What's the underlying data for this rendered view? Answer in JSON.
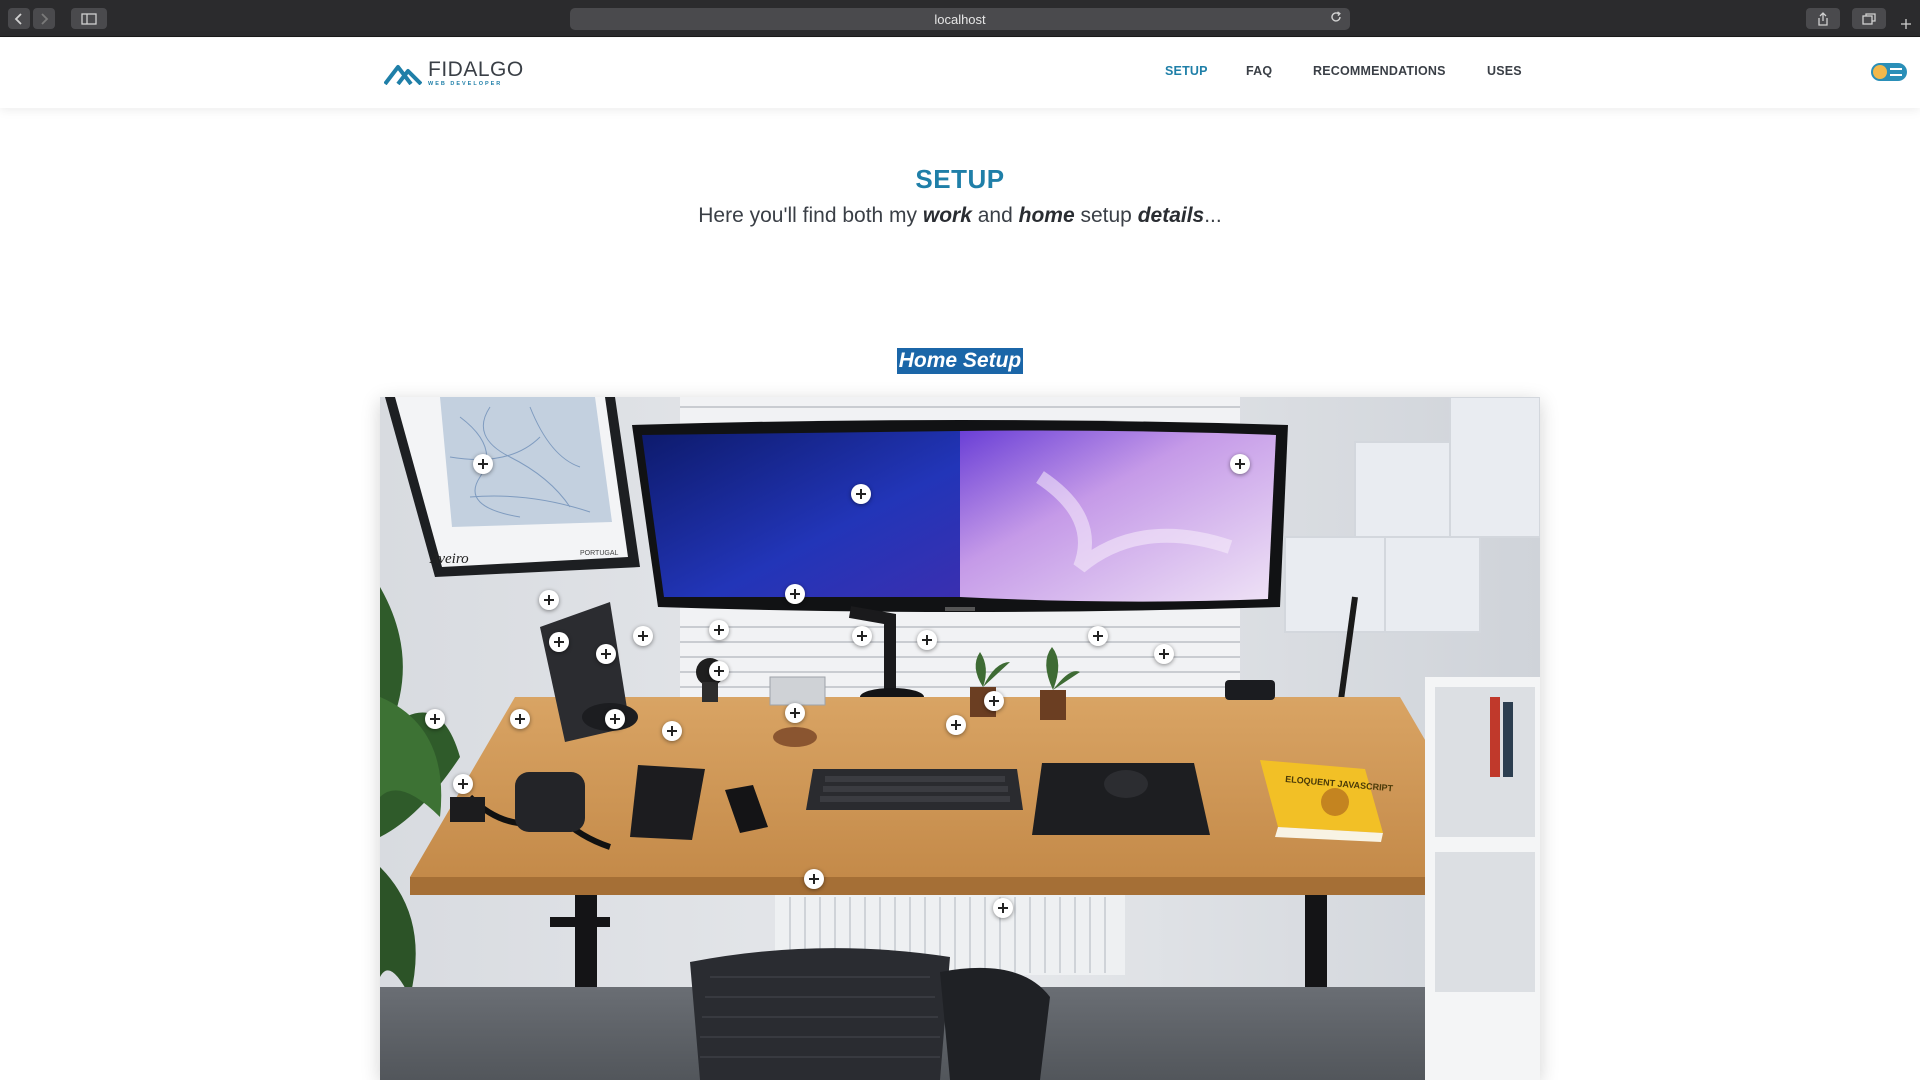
{
  "browser": {
    "address": "localhost"
  },
  "header": {
    "logo": {
      "name": "FIDALGO",
      "tagline": "WEB DEVELOPER"
    },
    "nav": [
      {
        "label": "SETUP",
        "active": true
      },
      {
        "label": "FAQ",
        "active": false
      },
      {
        "label": "RECOMMENDATIONS",
        "active": false
      },
      {
        "label": "USES",
        "active": false
      }
    ]
  },
  "main": {
    "title": "SETUP",
    "subtitle": {
      "p1": "Here you'll find both my ",
      "work": "work",
      "p2": " and ",
      "home": "home",
      "p3": " setup ",
      "details": "details",
      "p4": "..."
    },
    "section_heading": "Home Setup",
    "map_poster": {
      "country": "PORTUGAL",
      "signature": "Aveiro"
    },
    "book_title": "ELOQUENT JAVASCRIPT"
  },
  "colors": {
    "accent": "#1f7fa8",
    "highlight": "#1b66a8",
    "text": "#3a3f46",
    "chrome": "#2b2b2d"
  }
}
